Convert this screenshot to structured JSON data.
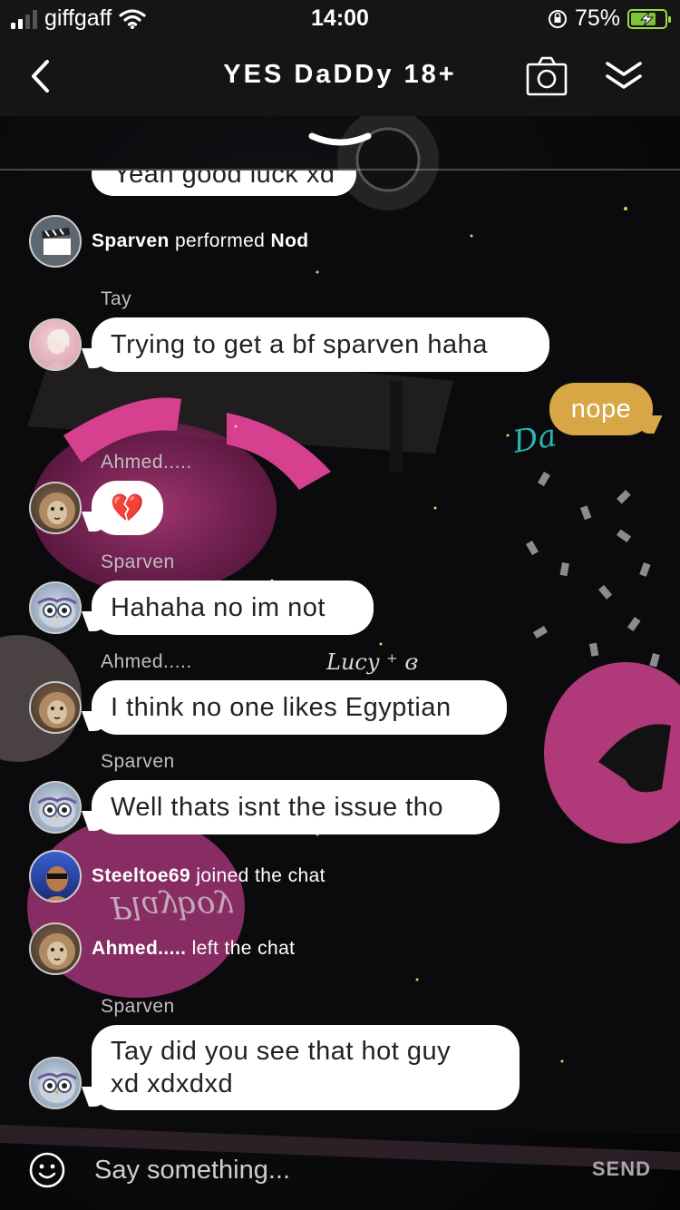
{
  "status_bar": {
    "carrier": "giffgaff",
    "time": "14:00",
    "battery_percent": "75%",
    "battery_level": 0.75,
    "signal_bars": 2
  },
  "header": {
    "title": "YES DaDDy 18+",
    "back_icon": "chevron-left-icon",
    "camera_icon": "camera-icon",
    "collapse_icon": "double-chevron-down-icon"
  },
  "scene_text": {
    "lucy_tag": "Lucy ⁺ ɞ",
    "sign_text": "Da",
    "playboy_text": "Playboy"
  },
  "chat": {
    "partial_message": "Yeah good luck xd",
    "action": {
      "user": "Sparven",
      "verb": "performed",
      "emote": "Nod"
    },
    "messages": [
      {
        "sender": "Tay",
        "text": "Trying to get a bf sparven haha"
      },
      {
        "sender": "",
        "text": "nope",
        "mine": true
      },
      {
        "sender": "Ahmed.....",
        "text": "💔"
      },
      {
        "sender": "Sparven",
        "text": "Hahaha no im not"
      },
      {
        "sender": "Ahmed.....",
        "text": "I think no one likes Egyptian"
      },
      {
        "sender": "Sparven",
        "text": "Well thats isnt the issue tho"
      },
      {
        "sender": "Sparven",
        "text_line1": "Tay did you see that hot guy",
        "text_line2": "xd xdxdxd"
      }
    ],
    "joined": {
      "user": "Steeltoe69",
      "event": "joined the chat"
    },
    "left": {
      "user": "Ahmed.....",
      "event": "left the chat"
    }
  },
  "composer": {
    "placeholder": "Say something...",
    "send_label": "SEND",
    "emoji_icon": "smiley-icon"
  },
  "colors": {
    "header_bg": "#151515",
    "my_bubble": "#d7a645",
    "bubble": "#ffffff",
    "battery": "#9fd94a"
  }
}
